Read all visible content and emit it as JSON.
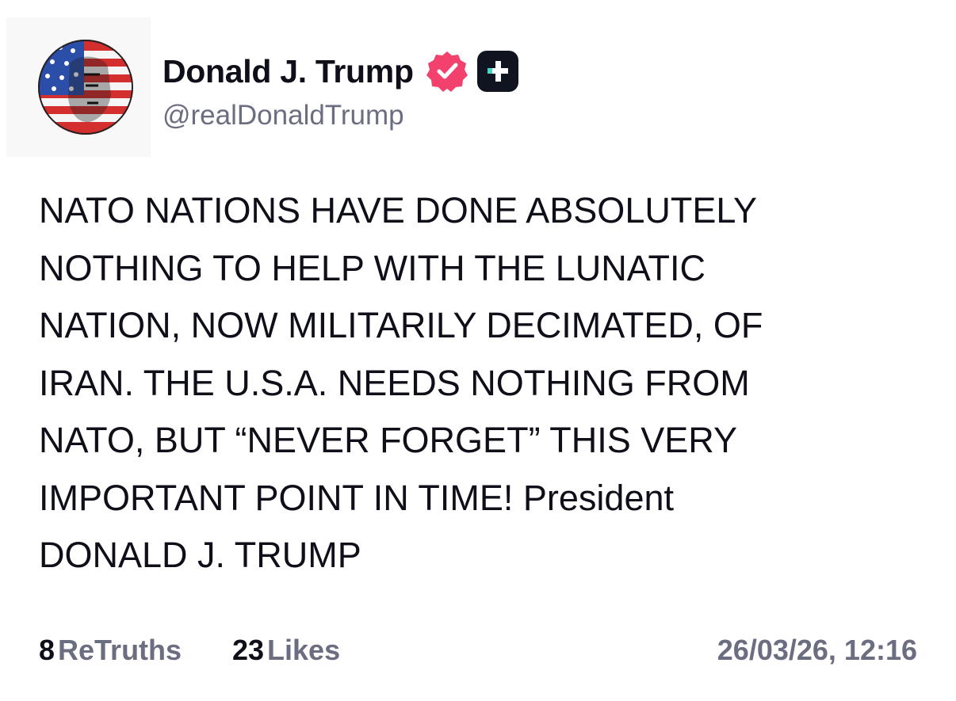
{
  "author": {
    "display_name": "Donald J. Trump",
    "handle": "@realDonaldTrump",
    "avatar_icon": "flag-portrait-avatar",
    "verified_icon": "verified-badge-icon",
    "verified_color": "#f2416d",
    "plus_icon": "truth-plus-icon",
    "plus_accent": "#3fd8c5"
  },
  "post": {
    "text": "NATO NATIONS HAVE DONE ABSOLUTELY\nNOTHING TO HELP WITH THE LUNATIC\nNATION, NOW MILITARILY DECIMATED, OF\nIRAN. THE U.S.A. NEEDS NOTHING FROM\nNATO, BUT “NEVER FORGET” THIS VERY\nIMPORTANT POINT IN TIME! President\nDONALD J. TRUMP"
  },
  "stats": {
    "retruths_count": "8",
    "retruths_label": "ReTruths",
    "likes_count": "23",
    "likes_label": "Likes"
  },
  "timestamp": "26/03/26, 12:16"
}
